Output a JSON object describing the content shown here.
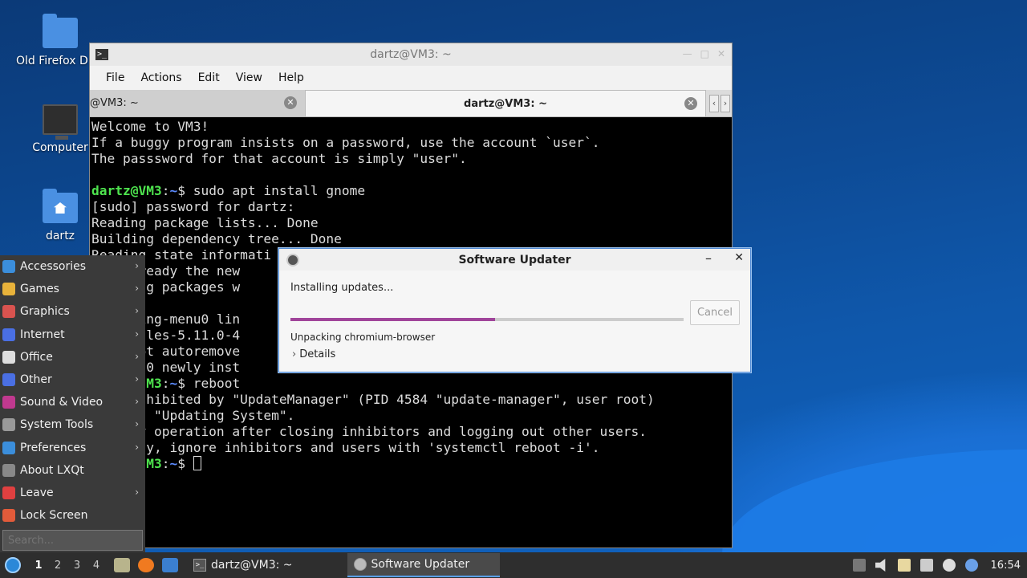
{
  "desktop": {
    "icons": [
      {
        "label": "Old Firefox D",
        "icon": "folder-icon"
      },
      {
        "label": "Computer",
        "icon": "computer-icon"
      },
      {
        "label": "dartz",
        "icon": "home-folder-icon"
      }
    ]
  },
  "terminal": {
    "title": "dartz@VM3: ~",
    "menu": [
      "File",
      "Actions",
      "Edit",
      "View",
      "Help"
    ],
    "tabs": [
      {
        "label": "@VM3: ~"
      },
      {
        "label": "dartz@VM3: ~"
      }
    ],
    "prompt_user": "dartz@VM3",
    "prompt_path": "~",
    "lines": [
      "Welcome to VM3!",
      "If a buggy program insists on a password, use the account `user`.",
      "The passsword for that account is simply \"user\".",
      "",
      "[sudo] password for dartz:",
      "Reading package lists... Done",
      "Building dependency tree... Done",
      "Reading state informati",
      "  s already the new",
      "  lowing packages w",
      "",
      "  ssaging-menu0 lin",
      "  -modules-5.11.0-4",
      "  do apt autoremove",
      "  ded, 0 newly inst",
      "  on inhibited by \"UpdateManager\" (PID 4584 \"update-manager\", user root)",
      "  on is \"Updating System\".",
      "  retry operation after closing inhibitors and logging out other users.",
      "  tively, ignore inhibitors and users with 'systemctl reboot -i'."
    ],
    "cmd1": " sudo apt install gnome",
    "cmd2": " reboot",
    "prompt_fragment": "M3",
    "prompt_fragment2": "M3"
  },
  "updater": {
    "title": "Software Updater",
    "status": "Installing updates...",
    "progress": 0.52,
    "substatus": "Unpacking chromium-browser",
    "details_label": "Details",
    "cancel_label": "Cancel",
    "progress_color": "#a0449a"
  },
  "start_menu": {
    "items": [
      {
        "label": "Accessories",
        "icon": "accessories-icon",
        "color": "#3b8edb",
        "submenu": true
      },
      {
        "label": "Games",
        "icon": "games-icon",
        "color": "#e8b23a",
        "submenu": true
      },
      {
        "label": "Graphics",
        "icon": "graphics-icon",
        "color": "#d9534f",
        "submenu": true
      },
      {
        "label": "Internet",
        "icon": "internet-icon",
        "color": "#4a6fe3",
        "submenu": true
      },
      {
        "label": "Office",
        "icon": "office-icon",
        "color": "#dddddd",
        "submenu": true
      },
      {
        "label": "Other",
        "icon": "other-icon",
        "color": "#4a6fe3",
        "submenu": true
      },
      {
        "label": "Sound & Video",
        "icon": "sound-video-icon",
        "color": "#c0398f",
        "submenu": true
      },
      {
        "label": "System Tools",
        "icon": "system-tools-icon",
        "color": "#999999",
        "submenu": true
      },
      {
        "label": "Preferences",
        "icon": "preferences-icon",
        "color": "#3b8edb",
        "submenu": true
      },
      {
        "label": "About LXQt",
        "icon": "about-icon",
        "color": "#888888",
        "submenu": false
      },
      {
        "label": "Leave",
        "icon": "leave-icon",
        "color": "#e04040",
        "submenu": true
      },
      {
        "label": "Lock Screen",
        "icon": "lock-icon",
        "color": "#e25b3a",
        "submenu": false
      }
    ],
    "search_placeholder": "Search..."
  },
  "taskbar": {
    "desktops": [
      "1",
      "2",
      "3",
      "4"
    ],
    "tasks": [
      {
        "label": "dartz@VM3: ~",
        "icon": "terminal-icon"
      },
      {
        "label": "Software Updater",
        "icon": "software-updater-icon"
      }
    ],
    "clock": "16:54"
  }
}
